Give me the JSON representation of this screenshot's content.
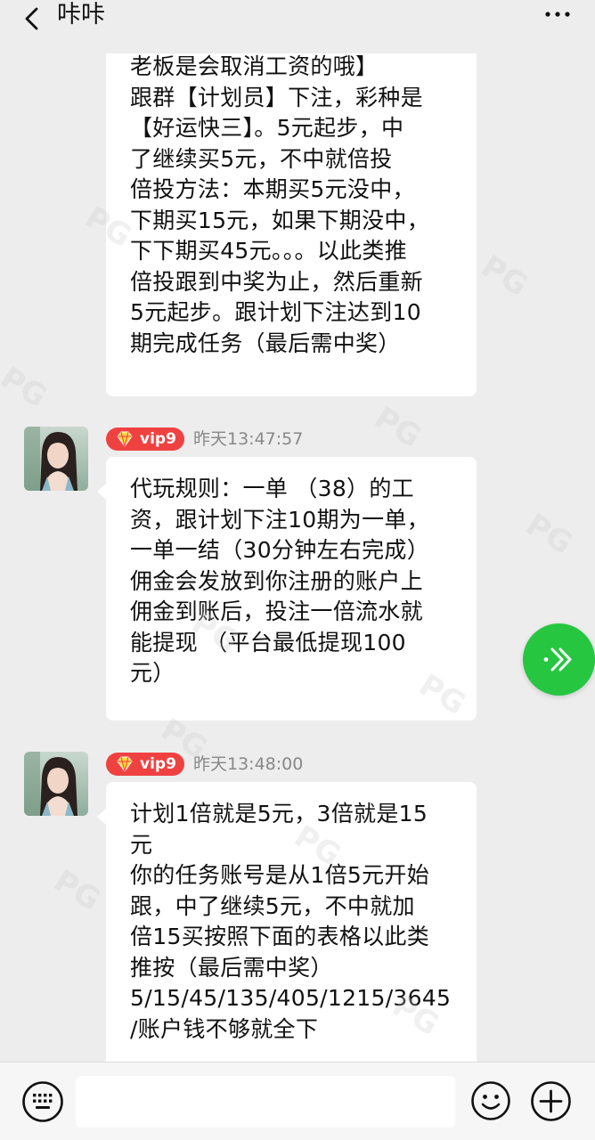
{
  "header": {
    "title": "咔咔"
  },
  "messages": [
    {
      "lines": [
        "老板是会取消工资的哦】",
        "跟群【计划员】下注，彩种是",
        "【好运快三】。5元起步，中",
        "了继续买5元，不中就倍投",
        "倍投方法：本期买5元没中，",
        "下期买15元，如果下期没中，",
        "下下期买45元。。。以此类推",
        "倍投跟到中奖为止，然后重新",
        "5元起步。跟计划下注达到10",
        "期完成任务（最后需中奖）"
      ]
    },
    {
      "vip": "vip9",
      "time": "昨天13:47:57",
      "lines": [
        "代玩规则：一单 （38）的工",
        "资，跟计划下注10期为一单，",
        "一单一结（30分钟左右完成）",
        "佣金会发放到你注册的账户上",
        "佣金到账后，投注一倍流水就",
        "能提现 （平台最低提现100",
        "元）"
      ]
    },
    {
      "vip": "vip9",
      "time": "昨天13:48:00",
      "lines": [
        "计划1倍就是5元，3倍就是15",
        "元",
        "你的任务账号是从1倍5元开始",
        "跟，中了继续5元，不中就加",
        "倍15买按照下面的表格以此类",
        "推按（最后需中奖）",
        "5/15/45/135/405/1215/3645",
        "/账户钱不够就全下"
      ]
    }
  ],
  "input": {
    "value": "",
    "placeholder": ""
  },
  "icons": {
    "back": "chevron-left-icon",
    "more": "more-dots-icon",
    "fab": "forward-chevrons-icon",
    "keyboard": "keyboard-icon",
    "emoji": "emoji-icon",
    "plus": "plus-icon",
    "vip": "gem-icon"
  },
  "colors": {
    "background": "#ededed",
    "bubble": "#ffffff",
    "vip_badge": "#f04141",
    "fab": "#26c640",
    "time_text": "#888888"
  },
  "watermark": {
    "text": "PG"
  }
}
